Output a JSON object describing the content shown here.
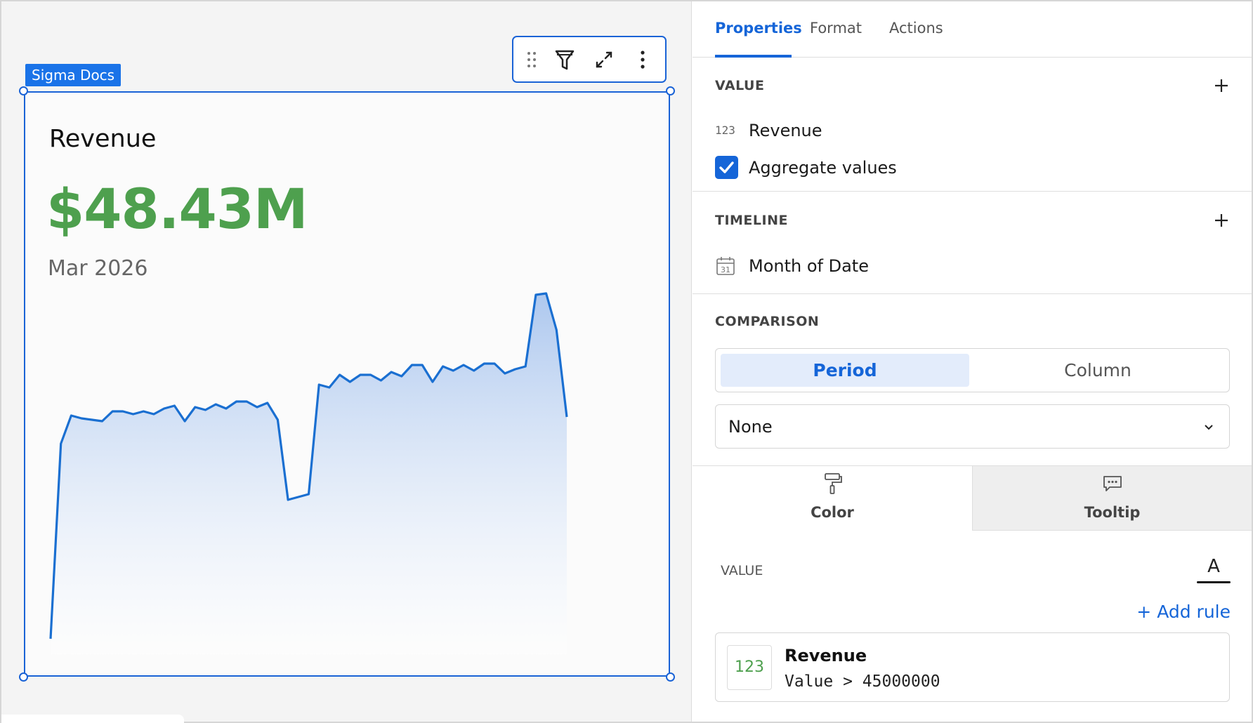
{
  "canvas": {
    "tag_label": "Sigma Docs",
    "card": {
      "title": "Revenue",
      "value": "$48.43M",
      "period": "Mar 2026"
    }
  },
  "chart_data": {
    "type": "area",
    "values": [
      20.5,
      34.4,
      36.4,
      36.2,
      36.1,
      36.0,
      36.7,
      36.7,
      36.5,
      36.7,
      36.5,
      36.9,
      37.1,
      36.0,
      37.0,
      36.8,
      37.2,
      36.9,
      37.4,
      37.4,
      37.0,
      37.3,
      36.1,
      30.4,
      30.6,
      30.8,
      38.6,
      38.4,
      39.3,
      38.8,
      39.3,
      39.3,
      38.9,
      39.5,
      39.2,
      40.0,
      40.0,
      38.8,
      39.9,
      39.6,
      40.0,
      39.6,
      40.1,
      40.1,
      39.4,
      39.7,
      39.9,
      45.0,
      45.1,
      42.5,
      36.3
    ],
    "color": "#1a6fd1",
    "fill": "#b9d0f0"
  },
  "toolbar": {
    "icons": [
      "drag-handle-icon",
      "filter-icon",
      "expand-icon",
      "more-vertical-icon"
    ]
  },
  "panel": {
    "tabs": [
      {
        "label": "Properties"
      },
      {
        "label": "Format"
      },
      {
        "label": "Actions"
      }
    ],
    "value_section": {
      "label": "VALUE",
      "field_icon": "123",
      "field": "Revenue",
      "aggregate_label": "Aggregate values"
    },
    "timeline_section": {
      "label": "TIMELINE",
      "field": "Month of Date"
    },
    "comparison_section": {
      "label": "COMPARISON",
      "options": [
        "Period",
        "Column"
      ],
      "selected": "None"
    },
    "subtabs": [
      {
        "label": "Color",
        "icon": "paint-roller-icon"
      },
      {
        "label": "Tooltip",
        "icon": "comment-icon"
      }
    ],
    "color_value_label": "VALUE",
    "font_letter": "A",
    "add_rule_label": "+ Add rule",
    "rule": {
      "badge": "123",
      "title": "Revenue",
      "condition": "Value > 45000000"
    },
    "accent": "#1565d8",
    "positive_color": "#4ea04e"
  }
}
